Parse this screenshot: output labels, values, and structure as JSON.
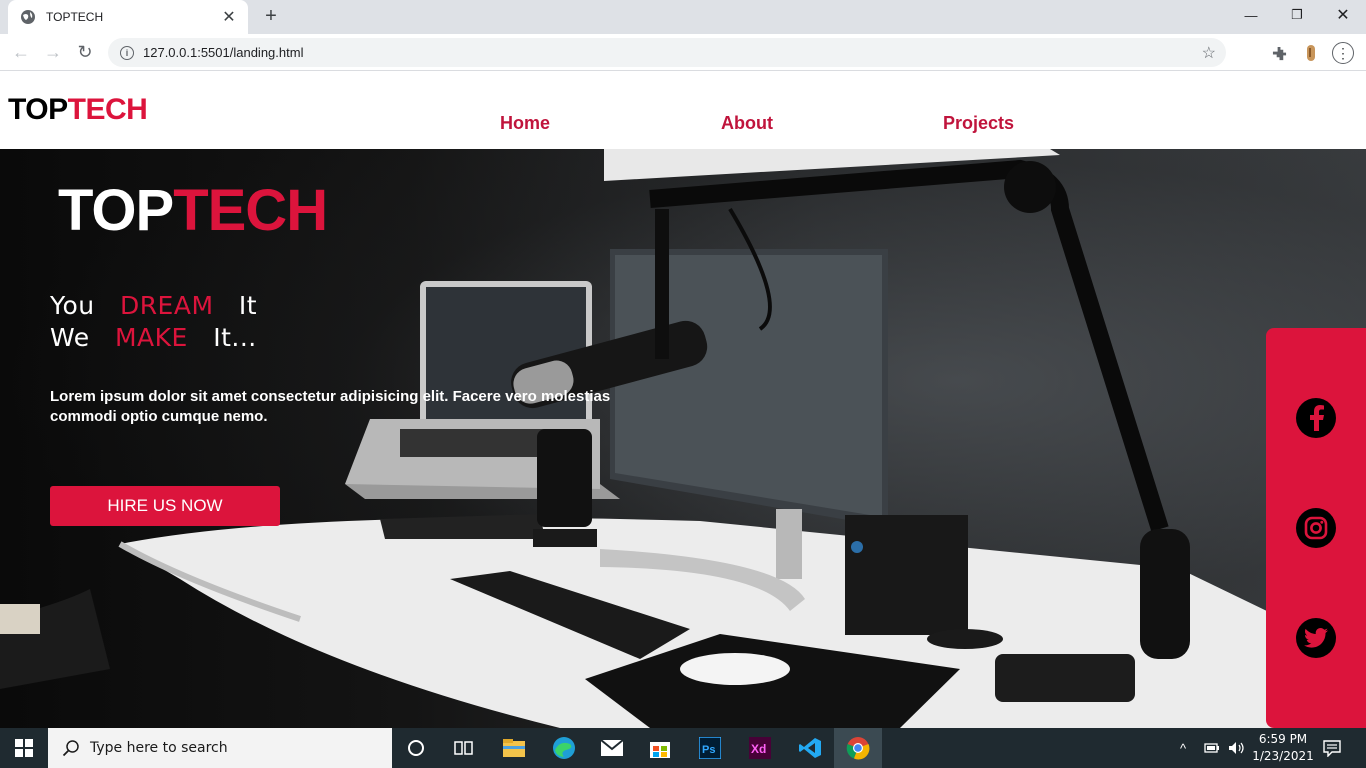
{
  "browser": {
    "tab_title": "TOPTECH",
    "url": "127.0.0.1:5501/landing.html"
  },
  "site": {
    "logo_part1": "TOP",
    "logo_part2": "TECH",
    "nav": [
      "Home",
      "About",
      "Projects"
    ]
  },
  "hero": {
    "title_part1": "TOP",
    "title_part2": "TECH",
    "line1": {
      "a": "You",
      "b": "DREAM",
      "c": "It"
    },
    "line2": {
      "a": "We",
      "b": "MAKE",
      "c": "It..."
    },
    "description": "Lorem ipsum dolor sit amet consectetur adipisicing elit. Facere vero molestias commodi optio cumque nemo.",
    "cta": "HIRE US NOW"
  },
  "social": [
    "facebook-icon",
    "instagram-icon",
    "twitter-icon"
  ],
  "taskbar": {
    "search_placeholder": "Type here to search",
    "time": "6:59 PM",
    "date": "1/23/2021"
  },
  "colors": {
    "accent": "#dc143c",
    "taskbar": "#1f2a30"
  }
}
